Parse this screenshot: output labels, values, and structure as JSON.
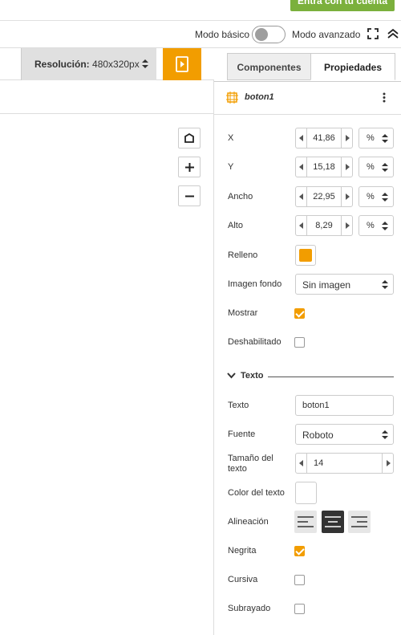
{
  "topbar": {
    "account_button": "Entra con tu cuenta"
  },
  "modebar": {
    "basic_label": "Modo básico",
    "advanced_label": "Modo avanzado"
  },
  "toolbar": {
    "resolution_label": "Resolución:",
    "resolution_value": "480x320px"
  },
  "tabs": [
    {
      "label": "Componentes"
    },
    {
      "label": "Propiedades"
    }
  ],
  "component": {
    "name": "boton1"
  },
  "properties": {
    "x": {
      "label": "X",
      "value": "41,86",
      "unit": "%"
    },
    "y": {
      "label": "Y",
      "value": "15,18",
      "unit": "%"
    },
    "width": {
      "label": "Ancho",
      "value": "22,95",
      "unit": "%"
    },
    "height": {
      "label": "Alto",
      "value": "8,29",
      "unit": "%"
    },
    "fill": {
      "label": "Relleno",
      "color": "#f29d00"
    },
    "bg_image": {
      "label": "Imagen fondo",
      "value": "Sin imagen"
    },
    "show": {
      "label": "Mostrar",
      "checked": true
    },
    "disabled": {
      "label": "Deshabilitado",
      "checked": false
    }
  },
  "text_section": {
    "title": "Texto",
    "text": {
      "label": "Texto",
      "value": "boton1"
    },
    "font": {
      "label": "Fuente",
      "value": "Roboto"
    },
    "size": {
      "label": "Tamaño del texto",
      "value": "14"
    },
    "color": {
      "label": "Color del texto",
      "color": "#ffffff"
    },
    "alignment": {
      "label": "Alineación",
      "options": [
        "left",
        "center",
        "right"
      ],
      "selected": "center"
    },
    "bold": {
      "label": "Negrita",
      "checked": true
    },
    "italic": {
      "label": "Cursiva",
      "checked": false
    },
    "underline": {
      "label": "Subrayado",
      "checked": false
    }
  },
  "colors": {
    "accent": "#f29d00",
    "account": "#7bb03c"
  }
}
